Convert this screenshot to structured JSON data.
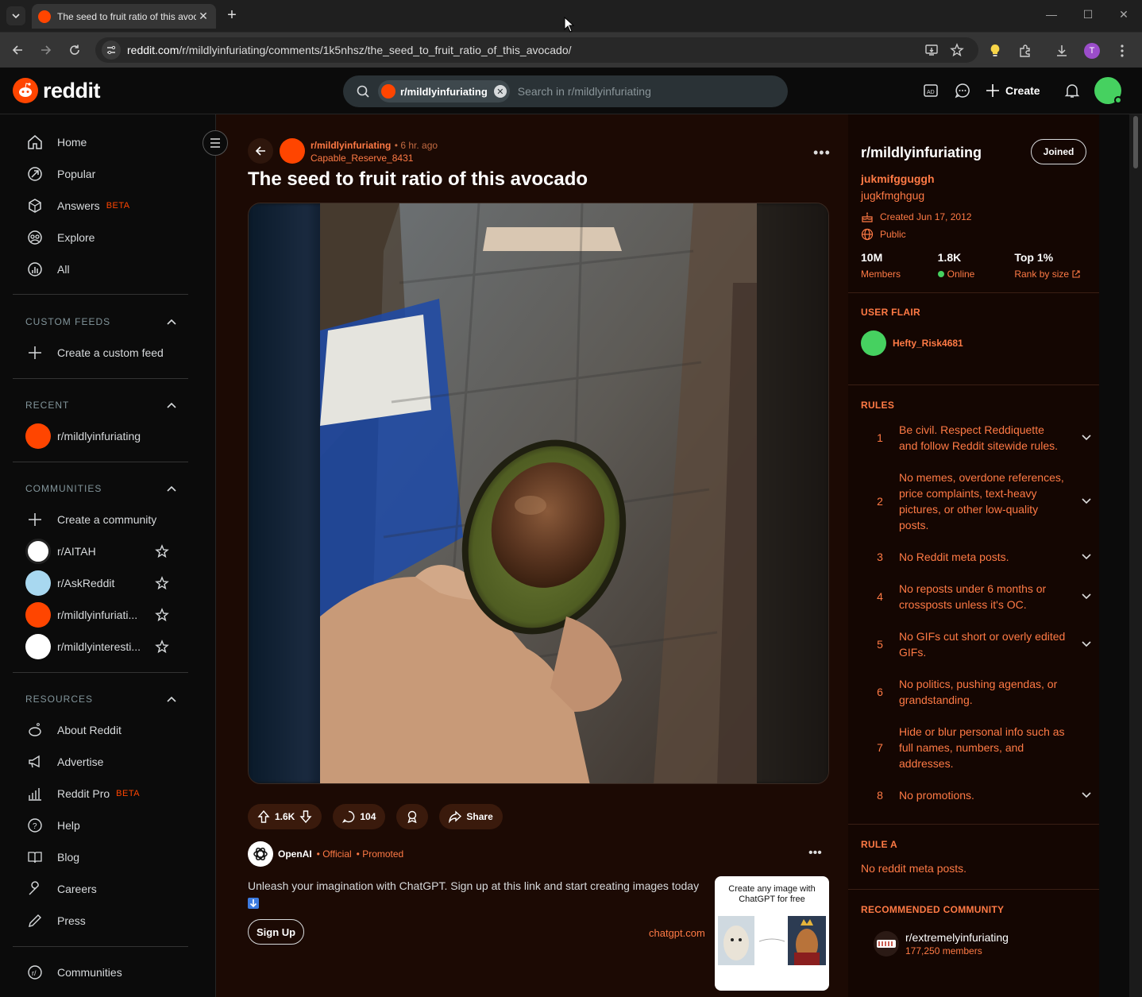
{
  "browser": {
    "tab_title": "The seed to fruit ratio of this avocado",
    "url_host": "reddit.com",
    "url_path": "/r/mildlyinfuriating/comments/1k5nhsz/the_seed_to_fruit_ratio_of_this_avocado/",
    "profile_initial": "T"
  },
  "header": {
    "logo_text": "reddit",
    "search_chip": "r/mildlyinfuriating",
    "search_placeholder": "Search in r/mildlyinfuriating",
    "create_label": "Create"
  },
  "sidebar": {
    "nav": [
      {
        "label": "Home"
      },
      {
        "label": "Popular"
      },
      {
        "label": "Answers",
        "badge": "BETA"
      },
      {
        "label": "Explore"
      },
      {
        "label": "All"
      }
    ],
    "custom_feeds_title": "CUSTOM FEEDS",
    "create_custom_feed": "Create a custom feed",
    "recent_title": "RECENT",
    "recent": [
      "r/mildlyinfuriating"
    ],
    "communities_title": "COMMUNITIES",
    "create_community": "Create a community",
    "communities": [
      "r/AITAH",
      "r/AskReddit",
      "r/mildlyinfuriati...",
      "r/mildlyinteresti..."
    ],
    "resources_title": "RESOURCES",
    "resources": [
      {
        "label": "About Reddit"
      },
      {
        "label": "Advertise"
      },
      {
        "label": "Reddit Pro",
        "badge": "BETA"
      },
      {
        "label": "Help"
      },
      {
        "label": "Blog"
      },
      {
        "label": "Careers"
      },
      {
        "label": "Press"
      }
    ],
    "communities_link": "Communities"
  },
  "post": {
    "subreddit": "r/mildlyinfuriating",
    "time": "• 6 hr. ago",
    "author": "Capable_Reserve_8431",
    "title": "The seed to fruit ratio of this avocado",
    "upvotes": "1.6K",
    "comments": "104",
    "share_label": "Share"
  },
  "promo": {
    "name": "OpenAI",
    "official": "• Official",
    "promoted": "• Promoted",
    "body": "Unleash your imagination with ChatGPT. Sign up at this link and start creating images today",
    "cta": "Sign Up",
    "domain": "chatgpt.com",
    "thumb_text": "Create any image with ChatGPT for free"
  },
  "right_sidebar": {
    "title": "r/mildlyinfuriating",
    "joined_label": "Joined",
    "tagline": "jukmifgguggh",
    "description": "jugkfmghgug",
    "created": "Created Jun 17, 2012",
    "visibility": "Public",
    "stats": [
      {
        "value": "10M",
        "label": "Members"
      },
      {
        "value": "1.8K",
        "label": "Online"
      },
      {
        "value": "Top 1%",
        "label": "Rank by size"
      }
    ],
    "user_flair_title": "USER FLAIR",
    "flair_user": "Hefty_Risk4681",
    "rules_title": "RULES",
    "rules": [
      {
        "num": "1",
        "text": "Be civil. Respect Reddiquette and follow Reddit sitewide rules."
      },
      {
        "num": "2",
        "text": "No memes, overdone references, price complaints, text-heavy pictures, or other low-quality posts."
      },
      {
        "num": "3",
        "text": "No Reddit meta posts."
      },
      {
        "num": "4",
        "text": "No reposts under 6 months or crossposts unless it's OC."
      },
      {
        "num": "5",
        "text": "No GIFs cut short or overly edited GIFs."
      },
      {
        "num": "6",
        "text": "No politics, pushing agendas, or grandstanding."
      },
      {
        "num": "7",
        "text": "Hide or blur personal info such as full names, numbers, and addresses."
      },
      {
        "num": "8",
        "text": "No promotions."
      }
    ],
    "rule_a_title": "RULE A",
    "rule_a_text": "No reddit meta posts.",
    "recommended_title": "RECOMMENDED COMMUNITY",
    "recommended_name": "r/extremelyinfuriating",
    "recommended_members": "177,250 members"
  },
  "colors": {
    "accent": "#ff4500",
    "link_orange": "#ff7a45",
    "main_bg": "#1c0a04",
    "sidebar_bg": "#140602"
  }
}
